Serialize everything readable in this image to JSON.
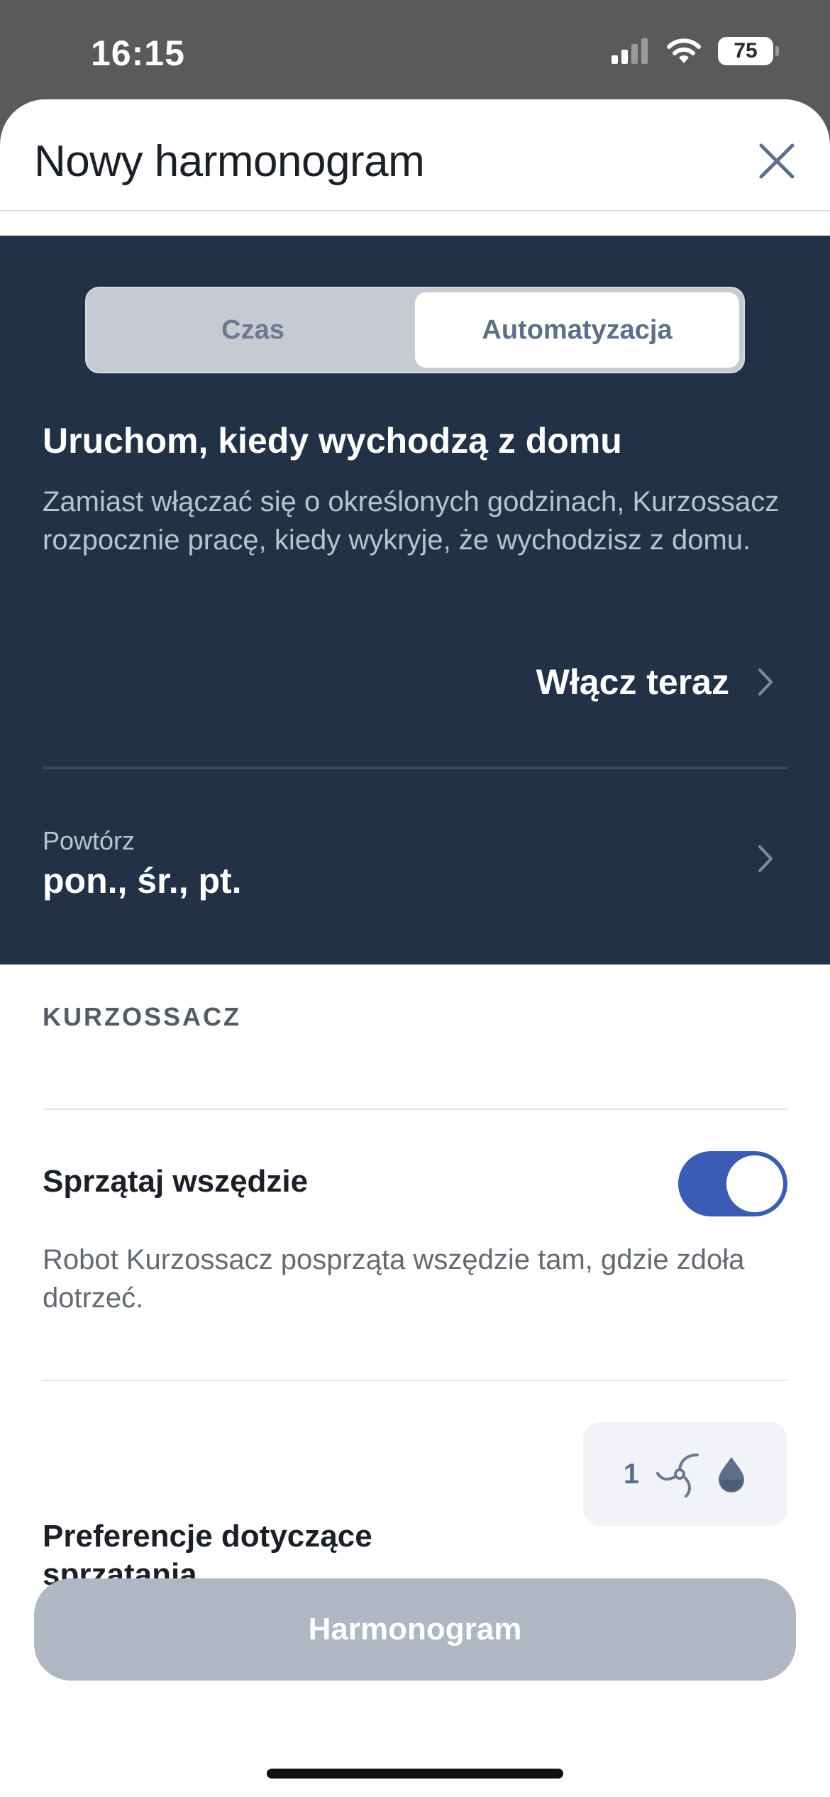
{
  "status_bar": {
    "time": "16:15",
    "battery_level": "75"
  },
  "header": {
    "title": "Nowy harmonogram"
  },
  "segmented": {
    "options": [
      "Czas",
      "Automatyzacja"
    ],
    "selected": "Automatyzacja"
  },
  "automation": {
    "heading": "Uruchom, kiedy wychodzą z domu",
    "description": "Zamiast włączać się o określonych godzinach, Kurzossacz rozpocznie pracę, kiedy wykryje, że wychodzisz z domu.",
    "enable_label": "Włącz teraz"
  },
  "repeat": {
    "label": "Powtórz",
    "value": "pon., śr., pt."
  },
  "device_section": {
    "label": "KURZOSSACZ",
    "clean_everywhere": {
      "title": "Sprzątaj wszędzie",
      "description": "Robot Kurzossacz posprząta wszędzie tam, gdzie zdoła dotrzeć.",
      "enabled": true
    },
    "preferences": {
      "title": "Preferencje dotyczące sprzątania",
      "passes": "1"
    }
  },
  "primary_button": {
    "label": "Harmonogram"
  },
  "colors": {
    "accent": "#3b5cb2",
    "panel": "#233146",
    "button_disabled": "#aeb7c2"
  },
  "icons": [
    "signal-icon",
    "wifi-icon",
    "battery-icon",
    "close-icon",
    "chevron-right-icon",
    "fan-icon",
    "water-drop-icon"
  ]
}
